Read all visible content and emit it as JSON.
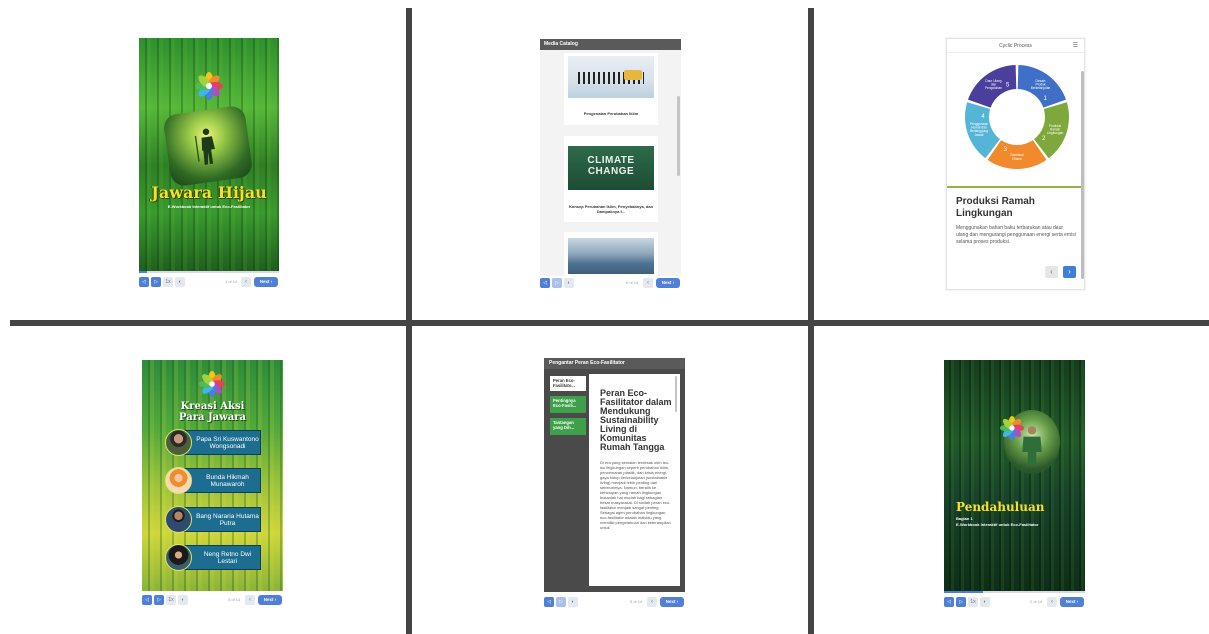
{
  "panel1": {
    "title": "Jawara Hijau",
    "subtitle": "E-Workbook Interaktif untuk Eco-Fasilitator",
    "controls": {
      "b1": "◁",
      "b2": "▷",
      "b3": "1x",
      "b4": "◐",
      "page": "1 of 14",
      "prev": "‹",
      "next": "Next ›"
    },
    "progress": 0.06
  },
  "panel2": {
    "header": "Media Catalog",
    "items": [
      {
        "caption": "Pengenalan Perubahan Iklim"
      },
      {
        "caption": "Konsep Perubahan Iklim, Penyebabnya, dan Dampaknya t...",
        "image_text_1": "CLIMATE",
        "image_text_2": "CHANGE"
      },
      {
        "caption": ""
      }
    ],
    "controls": {
      "b1": "◁",
      "b2": "▷",
      "b3": "◐",
      "page": "6 of 14",
      "prev": "‹",
      "next": "Next ›"
    }
  },
  "panel3": {
    "title": "Cyclic Process",
    "menu_icon": "☰",
    "segments": [
      "Desain Produk Berkelanjutan",
      "Produksi Ramah Lingkungan",
      "Distribusi Efisien",
      "Penggunaan Hemat dan Bertanggung Jawab",
      "Daur Ulang dan Pengolahan"
    ],
    "segment_numbers": [
      "1",
      "2",
      "3",
      "4",
      "5"
    ],
    "segment_colors": [
      "#3f6fc7",
      "#7ea83c",
      "#f08a2c",
      "#55b5d6",
      "#4b3f9c"
    ],
    "heading": "Produksi Ramah Lingkungan",
    "text": "Menggunakan bahan baku terbarukan atau daur ulang dan mengurangi penggunaan energi serta emisi selama proses produksi.",
    "prev": "‹",
    "next": "›"
  },
  "panel4": {
    "title_line1": "Kreasi Aksi",
    "title_line2": "Para Jawara",
    "people": [
      {
        "name": "Papa Sri Kuswantono Wongsonadi"
      },
      {
        "name": "Bunda Hikmah Munawaroh"
      },
      {
        "name": "Bang Nararia Hutama Putra"
      },
      {
        "name": "Neng Retno Dwi Lestari"
      }
    ],
    "controls": {
      "b1": "◁",
      "b2": "▷",
      "b3": "1x",
      "b4": "◐",
      "page": "3 of 14",
      "prev": "‹",
      "next": "Next ›"
    }
  },
  "panel5": {
    "header": "Pengantar Peran Eco-Fasilitator",
    "tabs": [
      "Peran Eco-Fasilitato...",
      "Pentingnya Eco-Fasili...",
      "Tantangan yang Dih..."
    ],
    "title": "Peran Eco-Fasilitator dalam Mendukung Sustainability Living di Komunitas Rumah Tangga",
    "body": "Di era yang semakin terdesak oleh isu-isu lingkungan seperti perubahan iklim, pencemaran plastik, dan krisis energi, gaya hidup berkelanjutan (sustainable living) menjadi lebih penting dari sebelumnya. Namun, beralih ke kehidupan yang ramah lingkungan bukanlah hal mudah bagi sebagian besar masyarakat. Di sinilah peran eco-fasilitator menjadi sangat penting. Sebagai agen perubahan lingkungan, eco-fasilitator adalah individu yang memiliki pengetahuan dan keterampilan untuk",
    "controls": {
      "b1": "◁",
      "b2": "▷",
      "b3": "◐",
      "page": "5 of 14",
      "prev": "‹",
      "next": "Next ›"
    }
  },
  "panel6": {
    "title": "Pendahuluan",
    "subtitle1": "Bagian 1",
    "subtitle2": "E-Workbook Interaktif untuk Eco-Fasilitator",
    "controls": {
      "b1": "◁",
      "b2": "▷",
      "b3": "1x",
      "b4": "◐",
      "page": "2 of 14",
      "prev": "‹",
      "next": "Next ›"
    },
    "progress": 0.28
  }
}
